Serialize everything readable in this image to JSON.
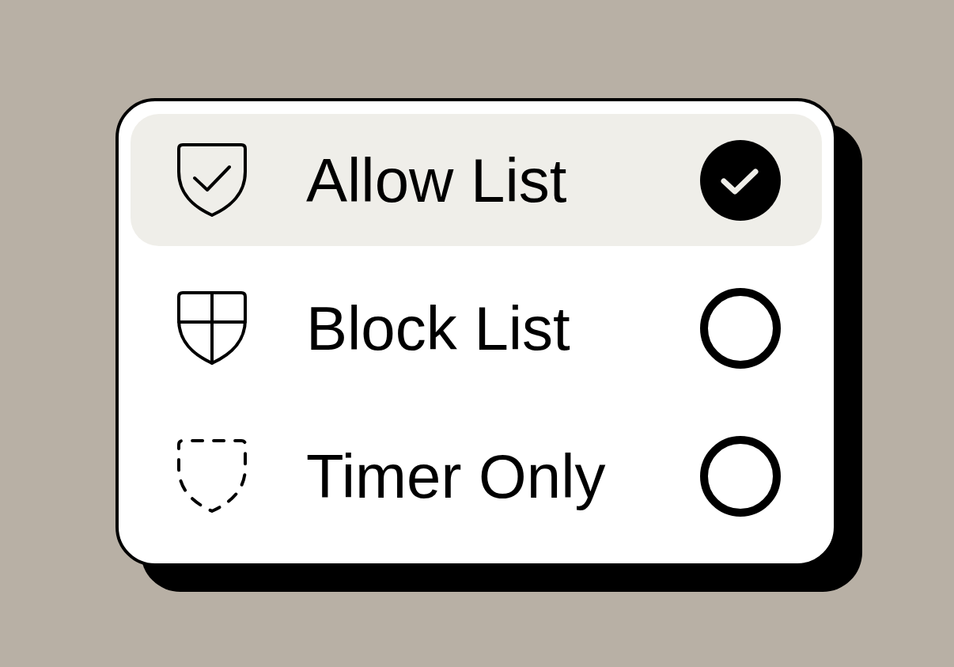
{
  "options": [
    {
      "label": "Allow List",
      "kind": "check",
      "selected": true
    },
    {
      "label": "Block List",
      "kind": "quartered",
      "selected": false
    },
    {
      "label": "Timer Only",
      "kind": "dashed",
      "selected": false
    }
  ]
}
